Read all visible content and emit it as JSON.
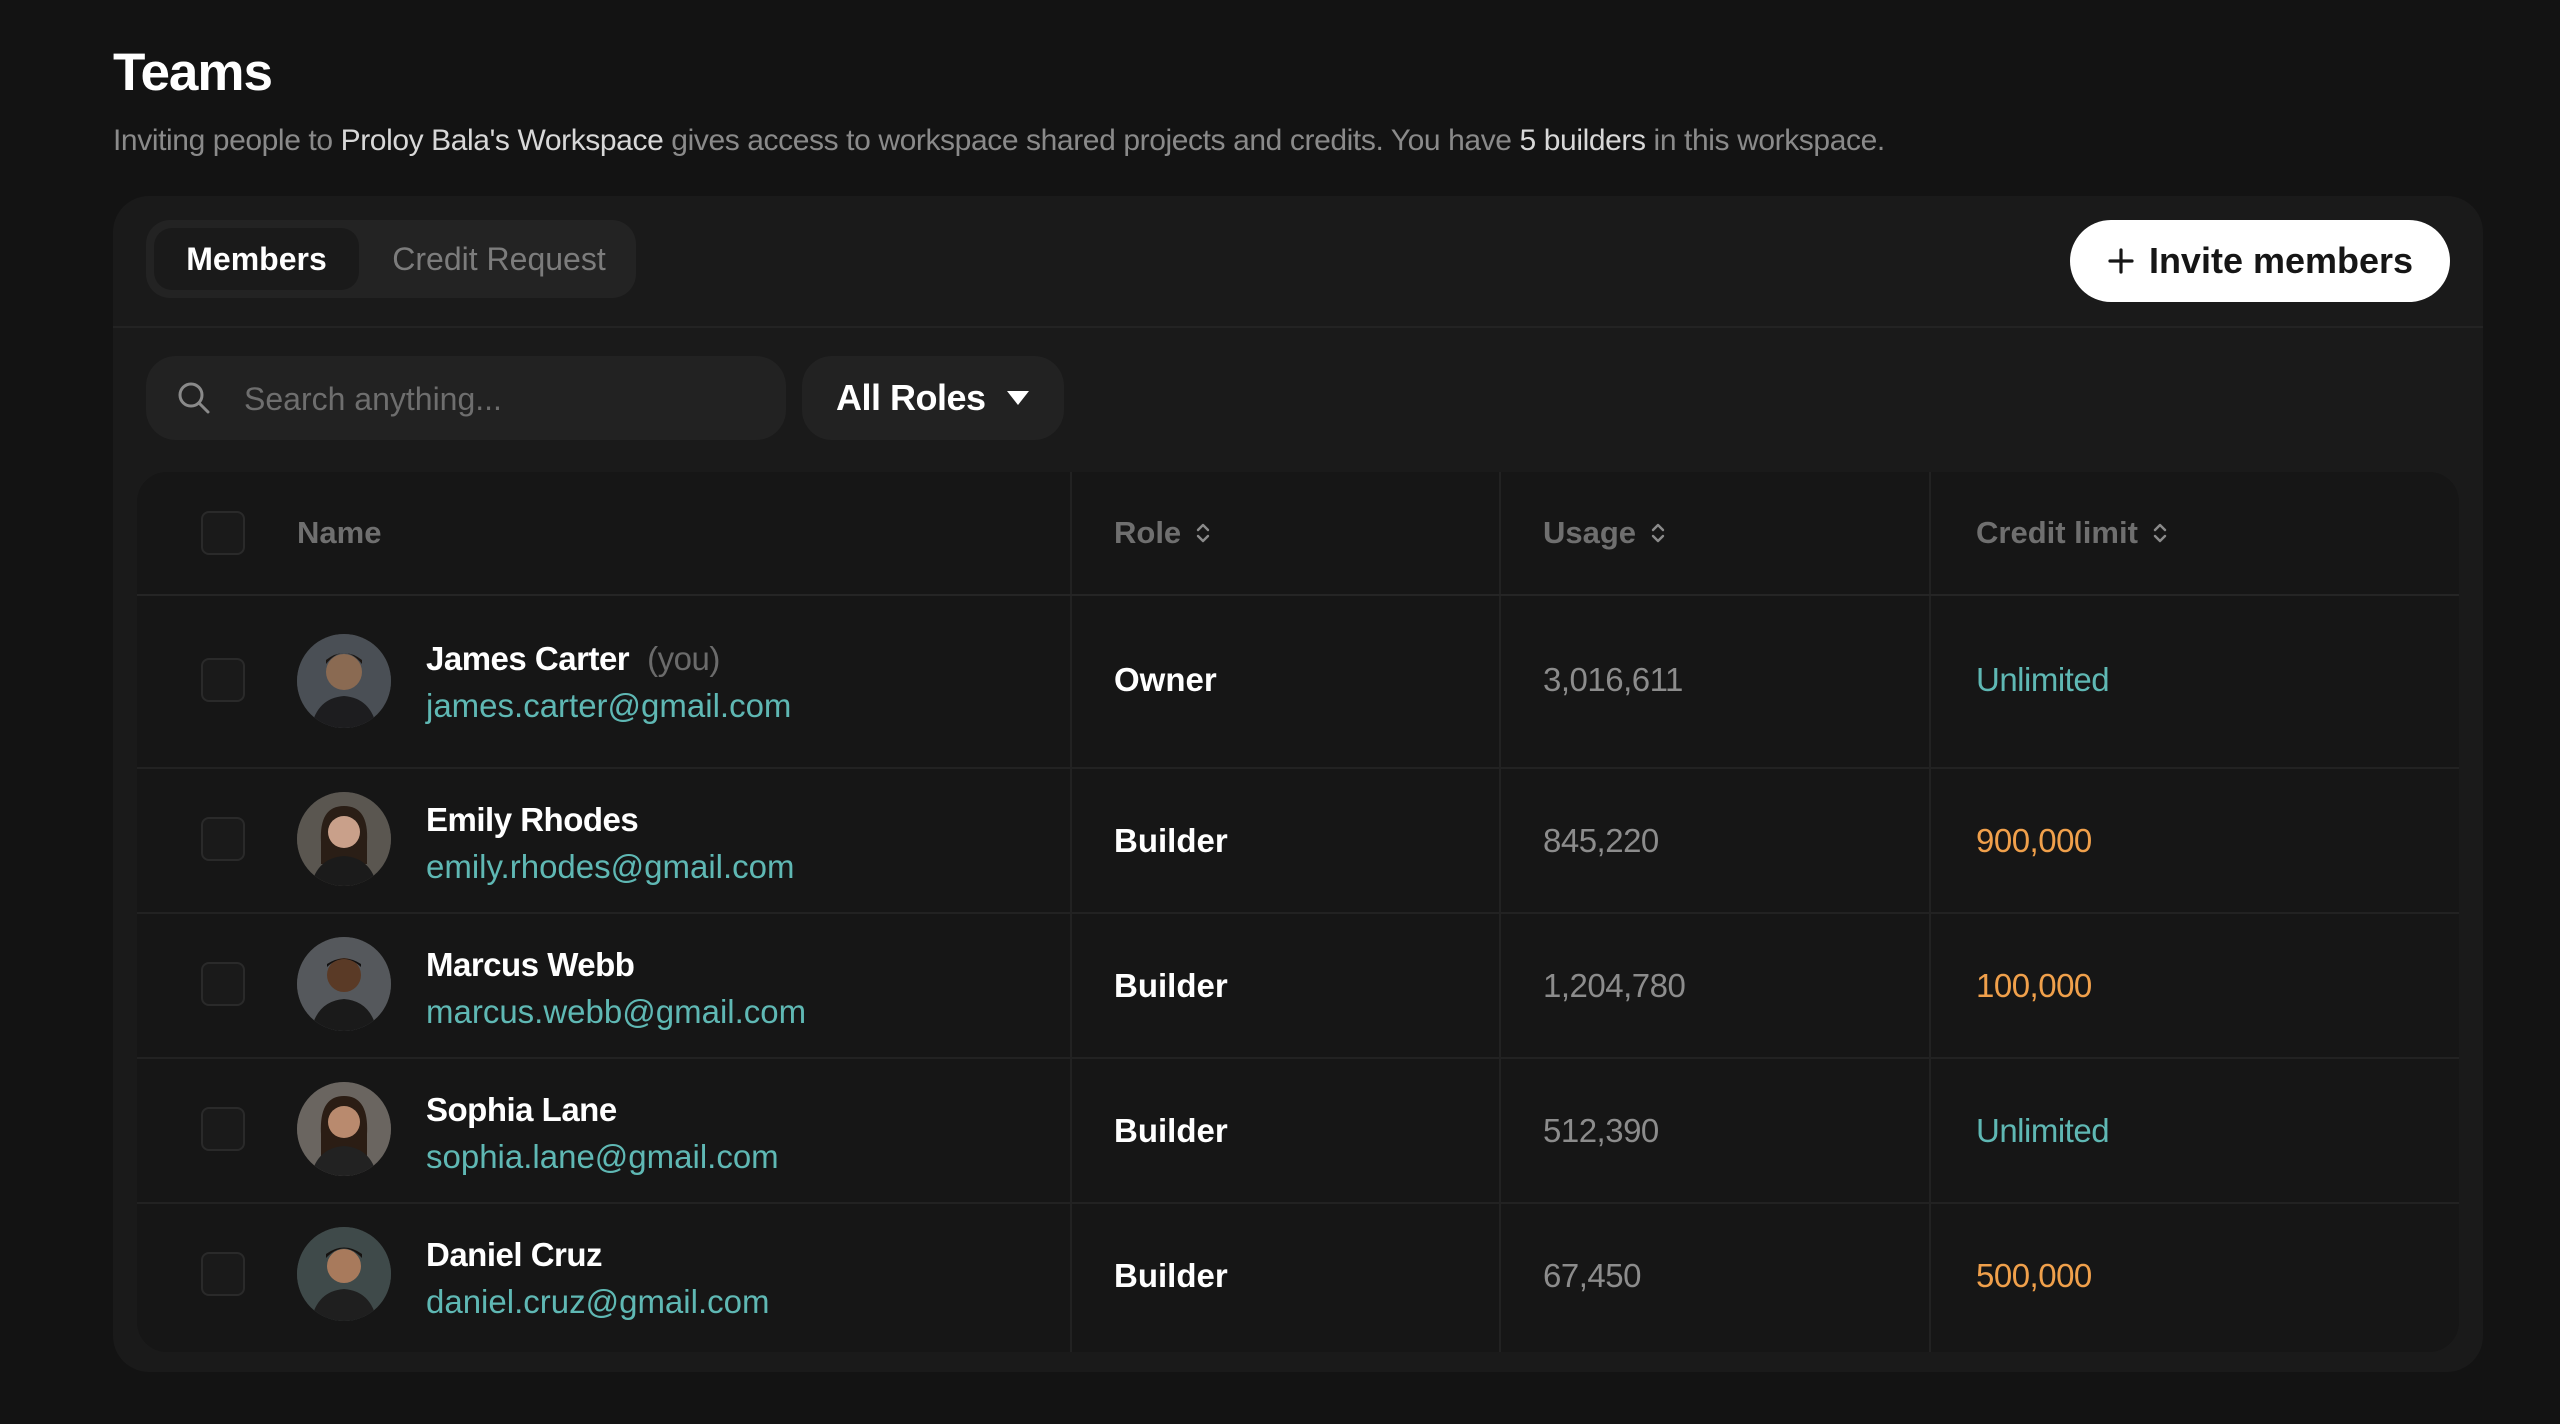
{
  "page": {
    "title": "Teams",
    "subtitle_parts": [
      "Inviting people to ",
      "Proloy Bala's Workspace",
      " gives access to workspace shared projects and credits. You have ",
      "5 builders",
      " in this workspace."
    ]
  },
  "tabs": [
    {
      "label": "Members",
      "active": true
    },
    {
      "label": "Credit Request",
      "active": false
    }
  ],
  "invite_button": {
    "label": "Invite members",
    "icon": "plus-icon"
  },
  "search": {
    "placeholder": "Search anything...",
    "value": "",
    "icon": "search-icon"
  },
  "role_filter": {
    "selected": "All Roles",
    "icon": "caret-down-icon"
  },
  "table": {
    "columns": [
      "Name",
      "Role",
      "Usage",
      "Credit limit"
    ],
    "rows": [
      {
        "name": "James Carter",
        "you": "(you)",
        "email": "james.carter@gmail.com",
        "role": "Owner",
        "usage": "3,016,611",
        "credit_limit": "Unlimited",
        "limit_color": "#5fb8b4"
      },
      {
        "name": "Emily Rhodes",
        "you": "",
        "email": "emily.rhodes@gmail.com",
        "role": "Builder",
        "usage": "845,220",
        "credit_limit": "900,000",
        "limit_color": "#f0a04b"
      },
      {
        "name": "Marcus Webb",
        "you": "",
        "email": "marcus.webb@gmail.com",
        "role": "Builder",
        "usage": "1,204,780",
        "credit_limit": "100,000",
        "limit_color": "#f0a04b"
      },
      {
        "name": "Sophia Lane",
        "you": "",
        "email": "sophia.lane@gmail.com",
        "role": "Builder",
        "usage": "512,390",
        "credit_limit": "Unlimited",
        "limit_color": "#5fb8b4"
      },
      {
        "name": "Daniel Cruz",
        "you": "",
        "email": "daniel.cruz@gmail.com",
        "role": "Builder",
        "usage": "67,450",
        "credit_limit": "500,000",
        "limit_color": "#f0a04b"
      }
    ]
  },
  "colors": {
    "background": "#131313",
    "panel": "#1a1a1a",
    "email": "#5fb8b4",
    "unlimited": "#5fb8b4",
    "limit_value": "#f0a04b"
  }
}
